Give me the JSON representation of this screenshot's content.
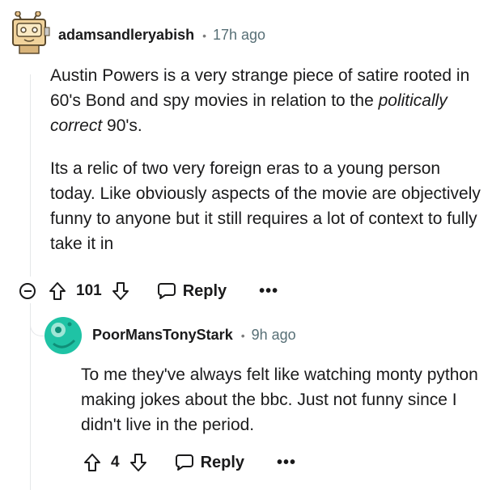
{
  "comment": {
    "username": "adamsandleryabish",
    "separator": "•",
    "time": "17h ago",
    "body": {
      "p1_before": "Austin Powers is a very strange piece of satire rooted in 60's Bond and spy movies in relation to the ",
      "p1_italic": "politically correct",
      "p1_after": " 90's.",
      "p2": "Its a relic of two very foreign eras to a young person today. Like obviously aspects of the movie are objectively funny to anyone but it still requires a lot of context to fully take it in"
    },
    "score": "101",
    "reply_label": "Reply",
    "more_label": "•••"
  },
  "reply": {
    "username": "PoorMansTonyStark",
    "separator": "•",
    "time": "9h ago",
    "body": "To me they've always felt like watching monty python making jokes about the bbc. Just not funny since I didn't live in the period.",
    "score": "4",
    "reply_label": "Reply",
    "more_label": "•••"
  },
  "colors": {
    "text": "#1a1a1b",
    "meta": "#576f76",
    "reply_avatar": "#1fc3a5",
    "thread_line": "#e5e7e9"
  }
}
